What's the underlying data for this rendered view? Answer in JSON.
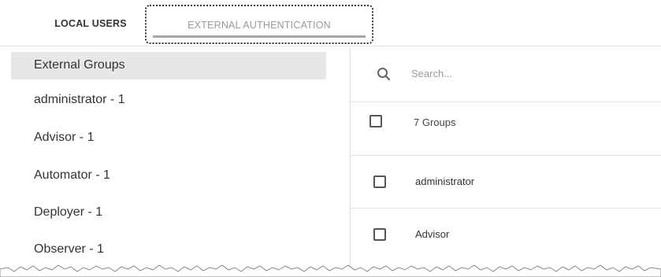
{
  "tabs": {
    "local_users": "LOCAL USERS",
    "external_authentication": "EXTERNAL AUTHENTICATION"
  },
  "left_panel": {
    "header": "External Groups",
    "items": [
      {
        "label": "administrator - 1"
      },
      {
        "label": "Advisor - 1"
      },
      {
        "label": "Automator - 1"
      },
      {
        "label": "Deployer - 1"
      },
      {
        "label": "Observer - 1"
      }
    ]
  },
  "right_panel": {
    "search_placeholder": "Search...",
    "count_label": "7 Groups",
    "rows": [
      {
        "label": "administrator"
      },
      {
        "label": "Advisor"
      }
    ]
  },
  "icons": {
    "search": "search-icon"
  }
}
